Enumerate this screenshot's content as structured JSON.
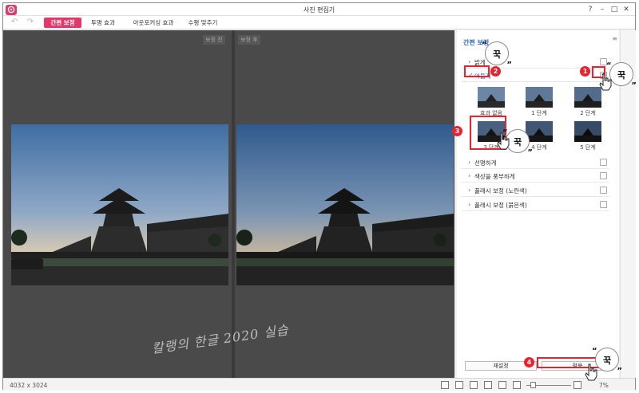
{
  "window": {
    "title": "사진 편집기",
    "help": "?",
    "minimize": "–",
    "maximize": "□",
    "close": "✕"
  },
  "toolbar": {
    "tabs": [
      {
        "label": "간편 보정",
        "active": true
      },
      {
        "label": "투명 효과",
        "active": false
      },
      {
        "label": "아웃포커싱 효과",
        "active": false
      },
      {
        "label": "수평 맞추기",
        "active": false
      }
    ]
  },
  "canvas": {
    "before_label": "보정 전",
    "after_label": "보정 후",
    "watermark": "칼랭의 한글 2020 실습"
  },
  "panel": {
    "title": "간편 보정",
    "options": [
      {
        "label": "밝게",
        "checked": false,
        "expanded": false
      },
      {
        "label": "어둡게",
        "checked": true,
        "expanded": true
      },
      {
        "label": "선명하게",
        "checked": false,
        "expanded": false
      },
      {
        "label": "색상을 풍부하게",
        "checked": false,
        "expanded": false
      },
      {
        "label": "플래시 보정 (노란색)",
        "checked": false,
        "expanded": false
      },
      {
        "label": "플래시 보정 (붉은색)",
        "checked": false,
        "expanded": false
      }
    ],
    "levels": [
      "효과 없음",
      "1 단계",
      "2 단계",
      "3 단계",
      "4 단계",
      "5 단계"
    ],
    "selected_level": "3 단계",
    "reset_button": "재설정",
    "apply_button": "적용"
  },
  "statusbar": {
    "image_size": "4032 x 3024",
    "zoom": "7%"
  },
  "annotations": {
    "steps": [
      "1",
      "2",
      "3",
      "4"
    ],
    "bubble_text": "꾹",
    "quote_open": "“",
    "quote_close": "”",
    "highlight_color": "#e8222e"
  },
  "colors": {
    "accent": "#e4386a",
    "panel_title": "#2a6ab8",
    "canvas_bg": "#4a4a4a"
  }
}
